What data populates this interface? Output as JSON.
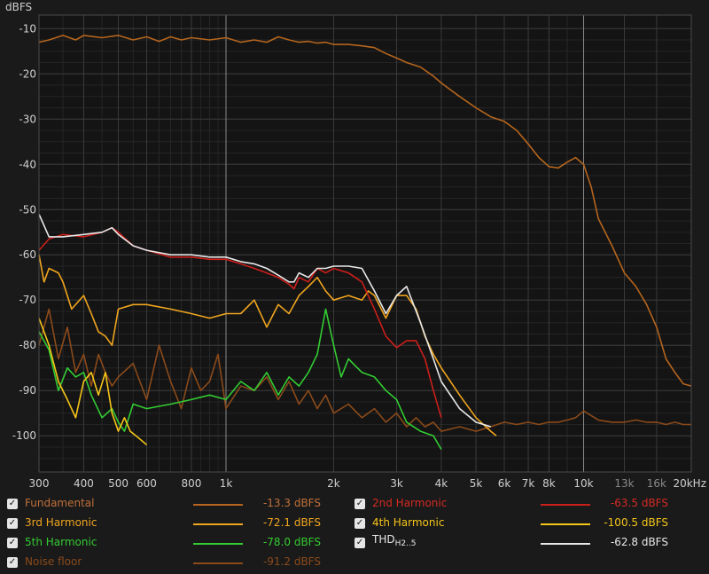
{
  "chart_data": {
    "type": "line",
    "ylabel": "dBFS",
    "x_scale": "log",
    "xlim": [
      300,
      20000
    ],
    "ylim": [
      -108,
      -7
    ],
    "y_ticks": [
      -10,
      -20,
      -30,
      -40,
      -50,
      -60,
      -70,
      -80,
      -90,
      -100
    ],
    "y_tick_labels": [
      "-10",
      "-20",
      "-30",
      "-40",
      "-50",
      "-60",
      "-70",
      "-80",
      "-90",
      "-100"
    ],
    "x_ticks": [
      300,
      400,
      500,
      600,
      800,
      1000,
      2000,
      3000,
      4000,
      5000,
      6000,
      7000,
      8000,
      10000,
      13000,
      16000,
      20000
    ],
    "x_tick_labels": [
      "300",
      "400",
      "500",
      "600",
      "800",
      "1k",
      "2k",
      "3k",
      "4k",
      "5k",
      "6k",
      "7k",
      "8k",
      "10k",
      "13k",
      "16k",
      "20kHz"
    ],
    "grid": true,
    "series": [
      {
        "name": "Fundamental",
        "color": "#b5651d",
        "x": [
          300,
          320,
          350,
          380,
          400,
          450,
          500,
          550,
          600,
          650,
          700,
          750,
          800,
          900,
          1000,
          1100,
          1200,
          1300,
          1400,
          1500,
          1600,
          1700,
          1800,
          1900,
          2000,
          2200,
          2400,
          2600,
          2800,
          3000,
          3200,
          3500,
          3800,
          4000,
          4500,
          5000,
          5500,
          6000,
          6500,
          7000,
          7500,
          8000,
          8500,
          9000,
          9500,
          10000,
          10500,
          11000,
          12000,
          13000,
          14000,
          15000,
          16000,
          17000,
          18000,
          19000,
          20000
        ],
        "values": [
          -13,
          -12.5,
          -11.5,
          -12.5,
          -11.5,
          -12,
          -11.5,
          -12.5,
          -11.8,
          -12.8,
          -11.8,
          -12.5,
          -12,
          -12.5,
          -12,
          -13,
          -12.5,
          -13,
          -11.8,
          -12.5,
          -13,
          -12.8,
          -13.2,
          -13,
          -13.5,
          -13.5,
          -13.8,
          -14.2,
          -15.5,
          -16.5,
          -17.5,
          -18.5,
          -20.5,
          -22,
          -25,
          -27.5,
          -29.5,
          -30.5,
          -32.5,
          -35.5,
          -38.5,
          -40.5,
          -40.8,
          -39.5,
          -38.5,
          -40,
          -45,
          -52,
          -58,
          -64,
          -67,
          -71,
          -76,
          -83,
          -86,
          -88.5,
          -89
        ]
      },
      {
        "name": "2nd Harmonic",
        "color": "#cc1f1a",
        "x": [
          300,
          320,
          350,
          400,
          450,
          480,
          500,
          550,
          600,
          700,
          800,
          900,
          1000,
          1100,
          1200,
          1300,
          1400,
          1500,
          1550,
          1600,
          1700,
          1800,
          1900,
          2000,
          2200,
          2400,
          2600,
          2800,
          3000,
          3200,
          3400,
          3600,
          3800,
          4000
        ],
        "values": [
          -59,
          -56.5,
          -55.5,
          -56,
          -55,
          -54,
          -55,
          -58,
          -59,
          -60.5,
          -60.5,
          -61,
          -61,
          -62,
          -63,
          -64,
          -65,
          -66.5,
          -67.5,
          -65,
          -66,
          -63,
          -64,
          -63,
          -64,
          -66,
          -72,
          -78,
          -80.5,
          -79,
          -79,
          -83,
          -90,
          -96
        ]
      },
      {
        "name": "3rd Harmonic",
        "color": "#f0a51e",
        "x": [
          300,
          310,
          320,
          340,
          350,
          370,
          400,
          420,
          440,
          460,
          480,
          500,
          550,
          600,
          700,
          800,
          900,
          1000,
          1100,
          1200,
          1300,
          1400,
          1500,
          1600,
          1700,
          1800,
          1900,
          2000,
          2200,
          2400,
          2500,
          2600,
          2800,
          3000,
          3200,
          3400,
          3600,
          3800,
          4000,
          4500,
          5000,
          5500,
          5700
        ],
        "values": [
          -60,
          -66,
          -63,
          -64,
          -66,
          -72,
          -69,
          -73,
          -77,
          -78,
          -80,
          -72,
          -71,
          -71,
          -72,
          -73,
          -74,
          -73,
          -73,
          -70,
          -76,
          -71,
          -73,
          -69,
          -67,
          -65,
          -68,
          -70,
          -69,
          -70,
          -68,
          -69,
          -74,
          -69,
          -69,
          -72,
          -78,
          -82,
          -85,
          -91,
          -96,
          -99,
          -100
        ]
      },
      {
        "name": "4th Harmonic",
        "color": "#f5c518",
        "x": [
          300,
          320,
          340,
          360,
          380,
          400,
          420,
          440,
          460,
          480,
          500,
          520,
          540,
          560,
          600
        ],
        "values": [
          -74,
          -80,
          -88,
          -92,
          -96,
          -88,
          -86,
          -91,
          -86,
          -95,
          -99,
          -96,
          -99,
          -100,
          -102
        ]
      },
      {
        "name": "5th Harmonic",
        "color": "#33cc33",
        "x": [
          300,
          320,
          340,
          360,
          380,
          400,
          420,
          450,
          480,
          500,
          520,
          550,
          600,
          700,
          800,
          900,
          1000,
          1100,
          1200,
          1300,
          1400,
          1500,
          1600,
          1700,
          1800,
          1900,
          2000,
          2100,
          2200,
          2400,
          2600,
          2800,
          3000,
          3200,
          3500,
          3800,
          4000
        ],
        "values": [
          -77,
          -81,
          -90,
          -85,
          -87,
          -86,
          -91,
          -96,
          -94,
          -97,
          -99,
          -93,
          -94,
          -93,
          -92,
          -91,
          -92,
          -88,
          -90,
          -86,
          -91,
          -87,
          -89,
          -86,
          -82,
          -72,
          -80,
          -87,
          -83,
          -86,
          -87,
          -90,
          -92,
          -97,
          -99,
          -100,
          -103
        ]
      },
      {
        "name": "THD",
        "color": "#e8e8e8",
        "x": [
          300,
          320,
          350,
          400,
          450,
          480,
          500,
          550,
          600,
          700,
          800,
          900,
          1000,
          1100,
          1200,
          1300,
          1400,
          1500,
          1550,
          1600,
          1700,
          1800,
          1900,
          2000,
          2200,
          2400,
          2600,
          2800,
          3000,
          3200,
          3500,
          3800,
          4000,
          4500,
          5000,
          5500
        ],
        "values": [
          -51,
          -56,
          -56,
          -55.5,
          -55,
          -54,
          -55.5,
          -58,
          -59,
          -60,
          -60,
          -60.5,
          -60.5,
          -61.5,
          -62,
          -63,
          -64.5,
          -66,
          -66,
          -64,
          -65,
          -63,
          -63,
          -62.5,
          -62.5,
          -63,
          -68,
          -73,
          -69,
          -67,
          -75,
          -83,
          -88,
          -94,
          -97,
          -98
        ]
      },
      {
        "name": "Noise floor",
        "color": "#8b4a1a",
        "x": [
          300,
          320,
          340,
          360,
          380,
          400,
          420,
          440,
          460,
          480,
          500,
          550,
          600,
          650,
          700,
          750,
          800,
          850,
          900,
          950,
          1000,
          1100,
          1200,
          1300,
          1400,
          1500,
          1600,
          1700,
          1800,
          1900,
          2000,
          2200,
          2400,
          2600,
          2800,
          3000,
          3200,
          3400,
          3600,
          3800,
          4000,
          4500,
          5000,
          5500,
          6000,
          6500,
          7000,
          7500,
          8000,
          8500,
          9000,
          9500,
          10000,
          11000,
          12000,
          13000,
          14000,
          15000,
          16000,
          17000,
          18000,
          19000,
          20000
        ],
        "values": [
          -80,
          -72,
          -83,
          -76,
          -86,
          -82,
          -89,
          -82,
          -86,
          -89,
          -87,
          -84,
          -92,
          -80,
          -88,
          -94,
          -85,
          -90,
          -88,
          -82,
          -94,
          -89,
          -90,
          -87,
          -92,
          -88,
          -93,
          -90,
          -94,
          -91,
          -95,
          -93,
          -96,
          -94,
          -97,
          -95,
          -98,
          -96,
          -98,
          -97,
          -99,
          -98,
          -99,
          -98,
          -97,
          -97.5,
          -97,
          -97.5,
          -97,
          -97,
          -96.5,
          -96,
          -94.5,
          -96.5,
          -97,
          -97,
          -96.5,
          -97,
          -97,
          -97.5,
          -97,
          -97.5,
          -97.5
        ]
      }
    ]
  },
  "legend": [
    {
      "checked": "✓",
      "name": "Fundamental",
      "value": "-13.3 dBFS",
      "color": "#b5651d",
      "text_color": "#c0703a"
    },
    {
      "checked": "✓",
      "name": "2nd Harmonic",
      "value": "-63.5 dBFS",
      "color": "#cc1f1a",
      "text_color": "#d42a22"
    },
    {
      "checked": "✓",
      "name": "3rd Harmonic",
      "value": "-72.1 dBFS",
      "color": "#f0a51e",
      "text_color": "#f0a51e"
    },
    {
      "checked": "✓",
      "name": "4th Harmonic",
      "value": "-100.5 dBFS",
      "color": "#f5c518",
      "text_color": "#f5c518"
    },
    {
      "checked": "✓",
      "name": "5th Harmonic",
      "value": "-78.0 dBFS",
      "color": "#33cc33",
      "text_color": "#33cc33"
    },
    {
      "checked": "✓",
      "name": "THD",
      "name_sub": "H2..5",
      "value": "-62.8 dBFS",
      "color": "#e8e8e8",
      "text_color": "#e8e8e8"
    },
    {
      "checked": "✓",
      "name": "Noise floor",
      "value": "-91.2 dBFS",
      "color": "#8b4a1a",
      "text_color": "#8b4a1a"
    }
  ]
}
